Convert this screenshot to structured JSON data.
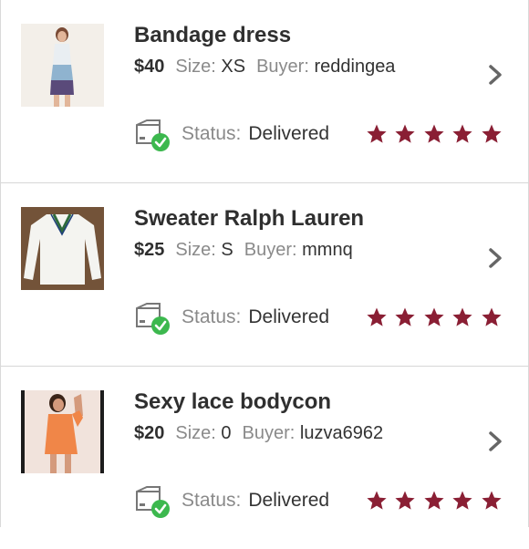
{
  "colors": {
    "star": "#8a1f34",
    "check_badge": "#3cb84e",
    "label_gray": "#8a8a8a",
    "chevron": "#666666"
  },
  "icons": {
    "status": "package-delivered-icon",
    "chevron": "chevron-right-icon",
    "rating": "star-icon"
  },
  "labels": {
    "size": "Size:",
    "buyer": "Buyer:",
    "status": "Status:"
  },
  "orders": [
    {
      "title": "Bandage dress",
      "price": "$40",
      "size": "XS",
      "buyer": "reddingea",
      "status": "Delivered",
      "rating": 5
    },
    {
      "title": "Sweater Ralph Lauren",
      "price": "$25",
      "size": "S",
      "buyer": "mmnq",
      "status": "Delivered",
      "rating": 5
    },
    {
      "title": "Sexy lace bodycon",
      "price": "$20",
      "size": "0",
      "buyer": "luzva6962",
      "status": "Delivered",
      "rating": 5
    }
  ]
}
